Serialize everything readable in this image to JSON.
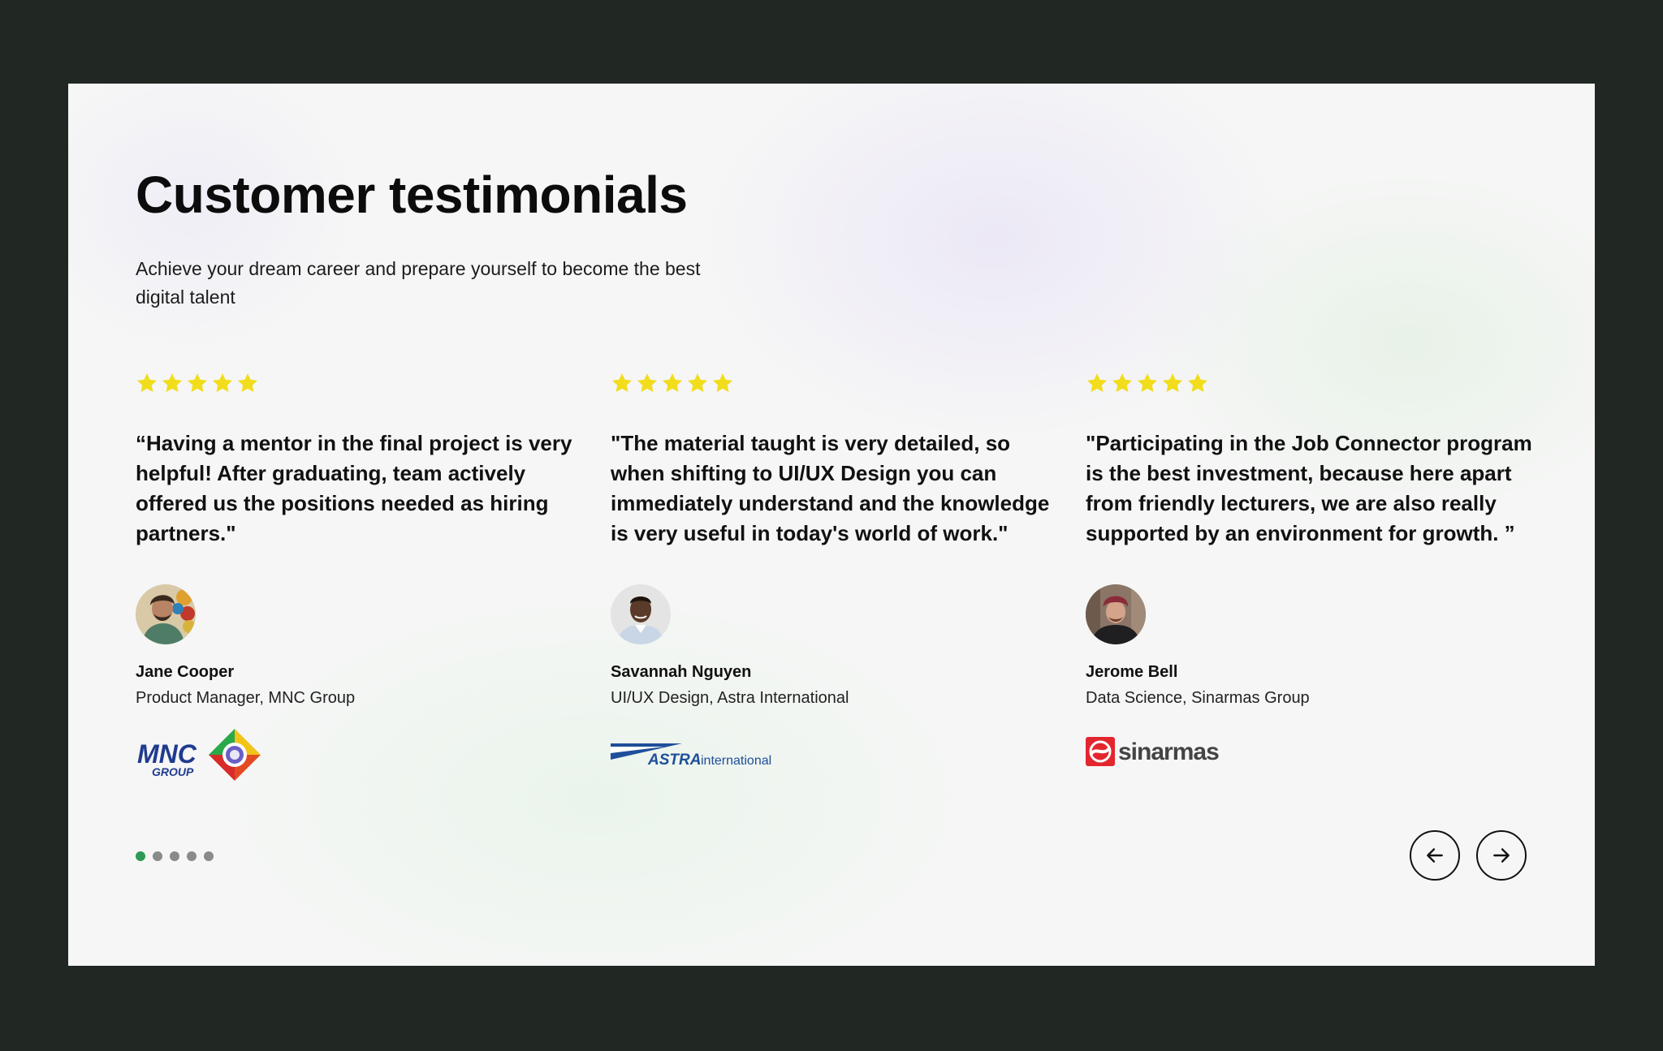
{
  "section": {
    "title": "Customer testimonials",
    "subtitle": "Achieve your dream career and prepare yourself to become the best digital talent"
  },
  "testimonials": [
    {
      "rating": 5,
      "quote": "“Having a mentor in the final project is very helpful! After graduating, team actively offered us the positions needed as hiring partners.\"",
      "name": "Jane Cooper",
      "role": "Product Manager, MNC Group",
      "logo": {
        "type": "mnc-group-logo",
        "text_main": "MNC",
        "text_sub": "GROUP"
      }
    },
    {
      "rating": 5,
      "quote": "\"The material taught is very detailed, so when shifting to UI/UX Design you can immediately understand and the knowledge is very useful in today's world of work.\"",
      "name": "Savannah Nguyen",
      "role": "UI/UX Design, Astra International",
      "logo": {
        "type": "astra-international-logo",
        "text_main": "ASTRA",
        "text_sub": "international"
      }
    },
    {
      "rating": 5,
      "quote": "\"Participating in the Job Connector program is the best investment, because here apart from friendly lecturers, we are also really supported by an environment for growth. ”",
      "name": "Jerome Bell",
      "role": "Data Science, Sinarmas Group",
      "logo": {
        "type": "sinarmas-logo",
        "text_main": "sinarmas"
      }
    }
  ],
  "pagination": {
    "total": 5,
    "active": 1
  },
  "icons": {
    "star": "star-icon",
    "prev": "arrow-left-icon",
    "next": "arrow-right-icon"
  },
  "colors": {
    "star": "#f1dd1c",
    "active_dot": "#2e9a55",
    "inactive_dot": "#8a8a8a",
    "background": "#212723"
  }
}
